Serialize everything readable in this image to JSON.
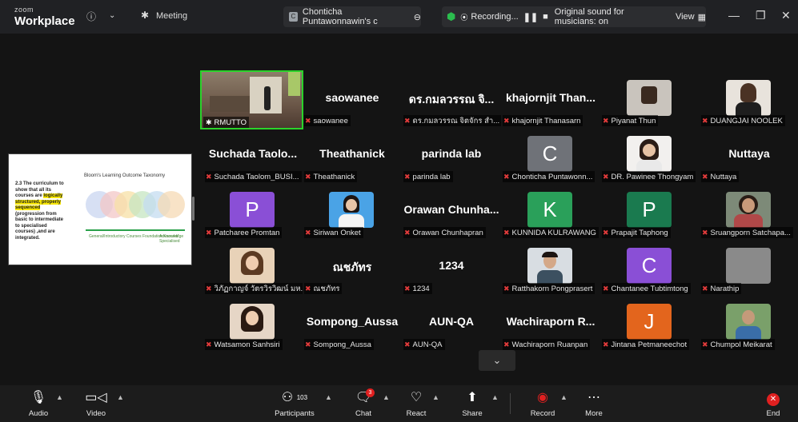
{
  "titlebar": {
    "brand_top": "zoom",
    "brand": "Workplace",
    "meeting_label": "Meeting",
    "tab_title": "Chonticha Puntawonnawin's c",
    "recording": "Recording...",
    "sound": "Original sound for musicians: on",
    "view": "View"
  },
  "share": {
    "text_plain1": "2.3 The curriculum to show that all its courses are ",
    "text_hl1": "logically structured, properly sequenced",
    "text_plain2": " (progression from basic to intermediate to specialised courses) ,and are integrated.",
    "title": "Bloom's Learning Outcome Taxonomy",
    "cap_left": "General/Introductory Courses Foundation Knowledge",
    "cap_right": "Advanced/ Specialised"
  },
  "participants": [
    {
      "big": "",
      "name": "RMUTTO"
    },
    {
      "big": "saowanee",
      "name": "saowanee"
    },
    {
      "big": "ดร.กมลวรรณ จิ...",
      "name": "ดร.กมลวรรณ จิตจักร สำ..."
    },
    {
      "big": "khajornjit Than...",
      "name": "khajornjit Thanasarn"
    },
    {
      "big": "",
      "name": "Piyanat Thun"
    },
    {
      "big": "",
      "name": "DUANGJAI NOOLEK"
    },
    {
      "big": "Suchada Taolo...",
      "name": "Suchada Taolom_BUSI..."
    },
    {
      "big": "Theathanick",
      "name": "Theathanick"
    },
    {
      "big": "parinda lab",
      "name": "parinda lab"
    },
    {
      "big": "",
      "name": "Chonticha Puntawonn..."
    },
    {
      "big": "",
      "name": "DR. Pawinee Thongyam"
    },
    {
      "big": "Nuttaya",
      "name": "Nuttaya"
    },
    {
      "big": "",
      "name": "Patcharee Promtan"
    },
    {
      "big": "",
      "name": "Siriwan Onket"
    },
    {
      "big": "Orawan Chunha...",
      "name": "Orawan Chunhapran"
    },
    {
      "big": "",
      "name": "KUNNIDA KULRAWANG"
    },
    {
      "big": "",
      "name": "Prapajit Taphong"
    },
    {
      "big": "",
      "name": "Sruangporn Satchapa..."
    },
    {
      "big": "",
      "name": "วิภัฏกาญจ์ วัตรวิรวิฒน์ มห..."
    },
    {
      "big": "ณชภัทร",
      "name": "ณชภัทร"
    },
    {
      "big": "1234",
      "name": "1234"
    },
    {
      "big": "",
      "name": "Ratthakorn Pongprasert"
    },
    {
      "big": "",
      "name": "Chantanee Tubtimtong"
    },
    {
      "big": "",
      "name": "Narathip"
    },
    {
      "big": "",
      "name": "Watsamon Sanhsiri"
    },
    {
      "big": "Sompong_Aussa",
      "name": "Sompong_Aussa"
    },
    {
      "big": "AUN-QA",
      "name": "AUN-QA"
    },
    {
      "big": "Wachiraporn R...",
      "name": "Wachiraporn Ruanpan"
    },
    {
      "big": "",
      "name": "Jintana Petmaneechot"
    },
    {
      "big": "",
      "name": "Chumpol Meikarat"
    }
  ],
  "avatars": {
    "c1": "C",
    "p1": "P",
    "k": "K",
    "p2": "P",
    "c2": "C",
    "j": "J"
  },
  "avatar_colors": {
    "c1": "#6f7278",
    "p1": "#8a4fd6",
    "k": "#2aa05a",
    "p2": "#1a7a4f",
    "c2": "#8a4fd6",
    "j": "#e3651d",
    "gray": "#8a8a8a"
  },
  "toolbar": {
    "audio": "Audio",
    "video": "Video",
    "participants": "Participants",
    "count": "103",
    "chat": "Chat",
    "chat_badge": "3",
    "react": "React",
    "share": "Share",
    "record": "Record",
    "more": "More",
    "end": "End"
  }
}
